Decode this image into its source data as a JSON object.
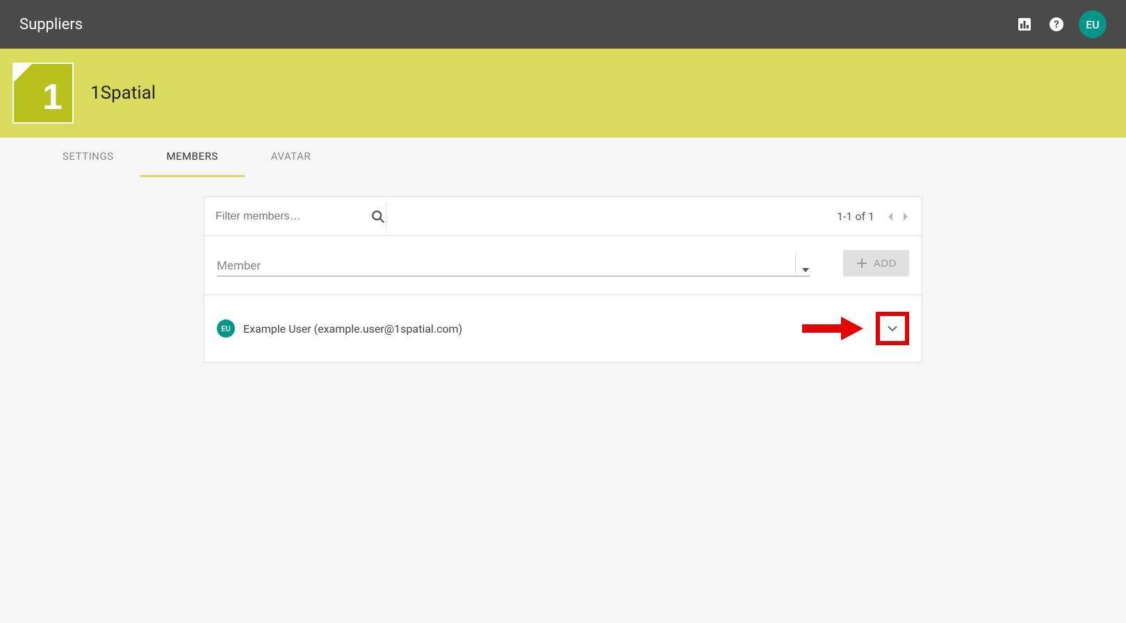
{
  "topbar": {
    "title": "Suppliers",
    "avatar_initials": "EU"
  },
  "banner": {
    "org_name": "1Spatial",
    "logo_char": "1"
  },
  "tabs": [
    {
      "label": "SETTINGS",
      "active": false
    },
    {
      "label": "MEMBERS",
      "active": true
    },
    {
      "label": "AVATAR",
      "active": false
    }
  ],
  "filter": {
    "placeholder": "Filter members…",
    "page_text": "1-1 of 1"
  },
  "add": {
    "select_label": "Member",
    "button_label": "ADD"
  },
  "members": [
    {
      "initials": "EU",
      "display": "Example User (example.user@1spatial.com)"
    }
  ]
}
